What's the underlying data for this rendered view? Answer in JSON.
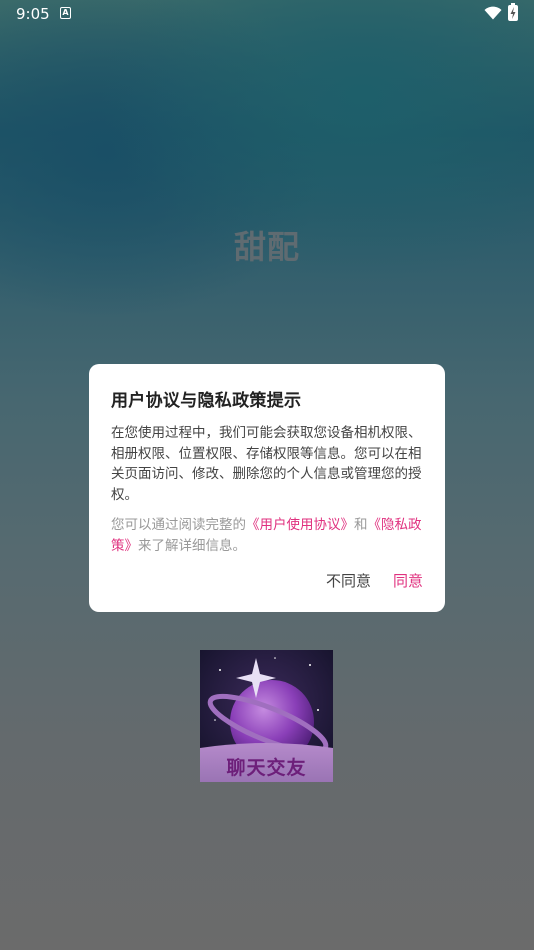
{
  "status_bar": {
    "time": "9:05",
    "notification_glyph": "A"
  },
  "app": {
    "title": "甜配"
  },
  "dialog": {
    "title": "用户协议与隐私政策提示",
    "body": "在您使用过程中，我们可能会获取您设备相机权限、相册权限、位置权限、存储权限等信息。您可以在相关页面访问、修改、删除您的个人信息或管理您的授权。",
    "note_prefix": "您可以通过阅读完整的",
    "user_agreement_link": "《用户使用协议》",
    "note_and": "和",
    "privacy_policy_link": "《隐私政策》",
    "note_suffix": "来了解详细信息。",
    "disagree_label": "不同意",
    "agree_label": "同意"
  },
  "logo": {
    "text": "聊天交友"
  },
  "colors": {
    "accent": "#e0317f",
    "dialog_bg": "#ffffff"
  }
}
